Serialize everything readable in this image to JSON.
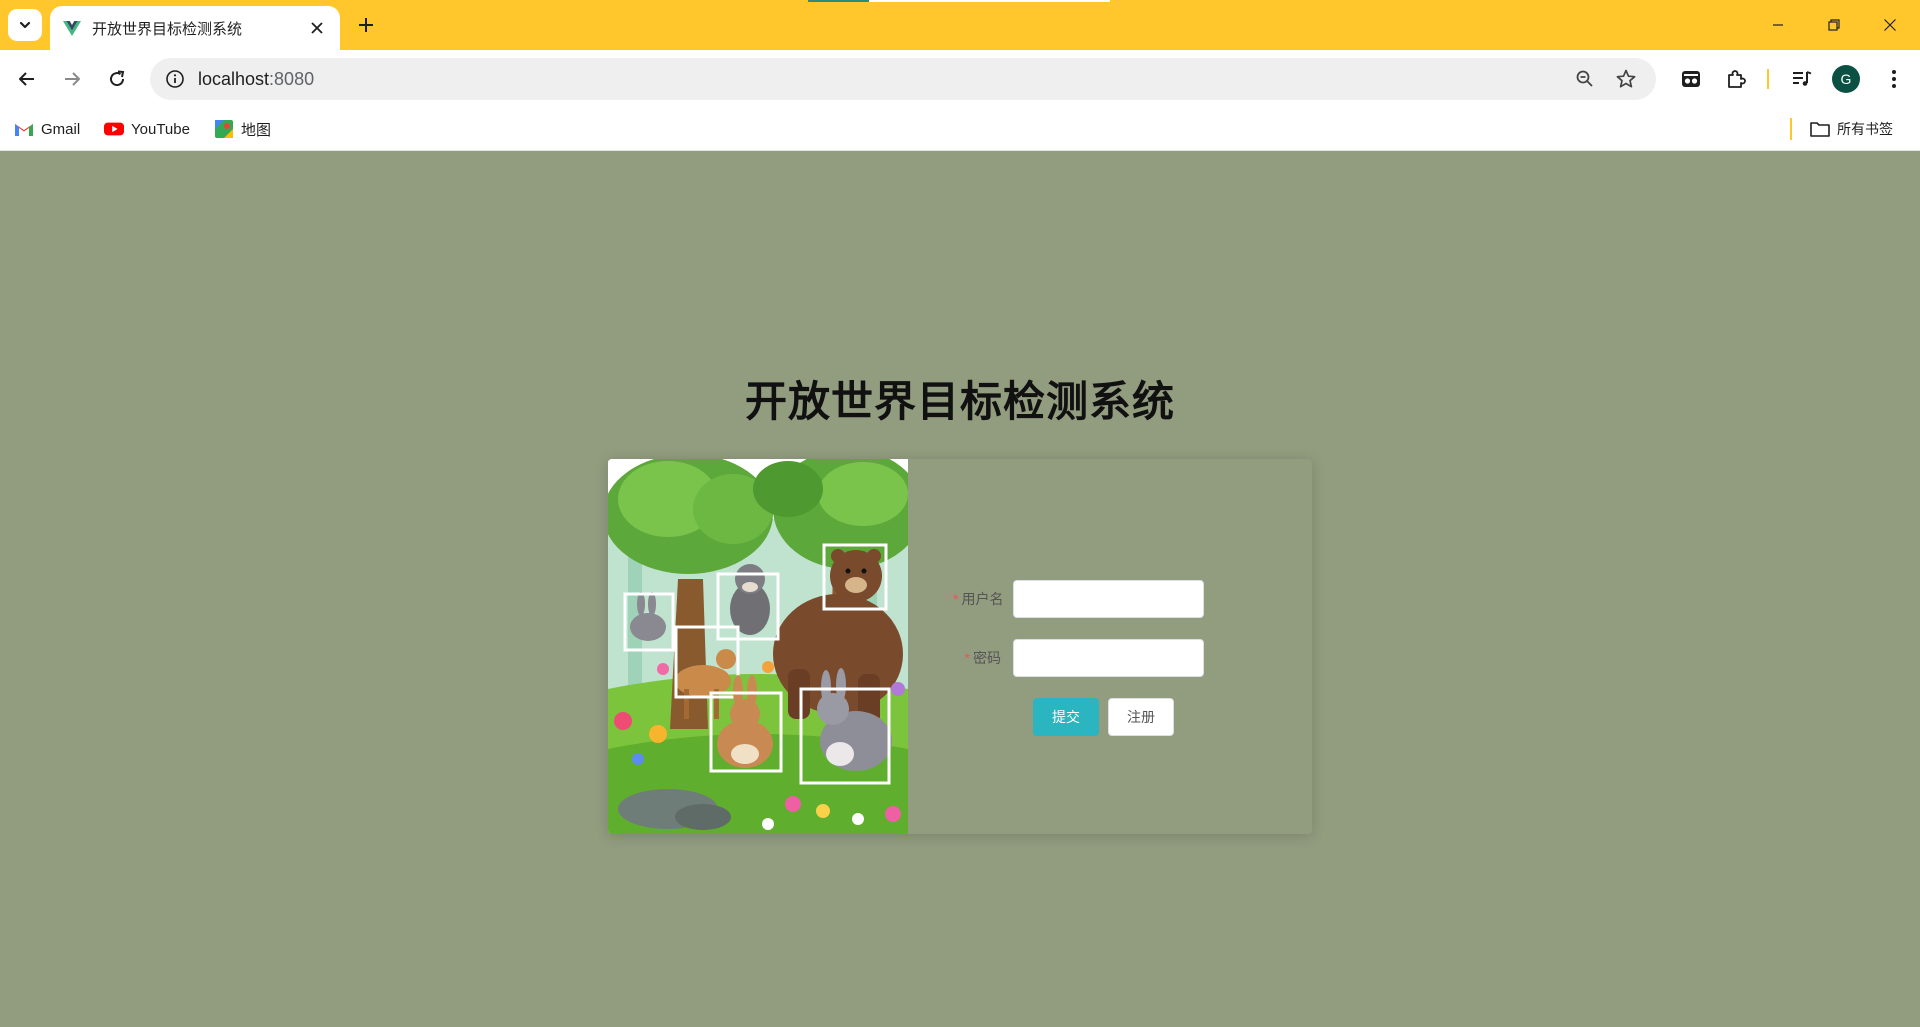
{
  "browser": {
    "tab_title": "开放世界目标检测系统",
    "url_host": "localhost",
    "url_port": ":8080",
    "avatar_letter": "G",
    "accent": "#ffc72c",
    "bookmarks": [
      {
        "label": "Gmail",
        "icon": "gmail-icon"
      },
      {
        "label": "YouTube",
        "icon": "youtube-icon"
      },
      {
        "label": "地图",
        "icon": "maps-icon"
      }
    ],
    "all_bookmarks_label": "所有书签"
  },
  "page": {
    "background": "#929c7f",
    "title": "开放世界目标检测系统",
    "illustration": "forest-animals-detection-illustration",
    "form": {
      "username_label": "用户名",
      "password_label": "密码",
      "required_mark": "*",
      "username_value": "",
      "password_value": "",
      "submit_label": "提交",
      "register_label": "注册",
      "submit_color": "#2ab5c0"
    }
  }
}
